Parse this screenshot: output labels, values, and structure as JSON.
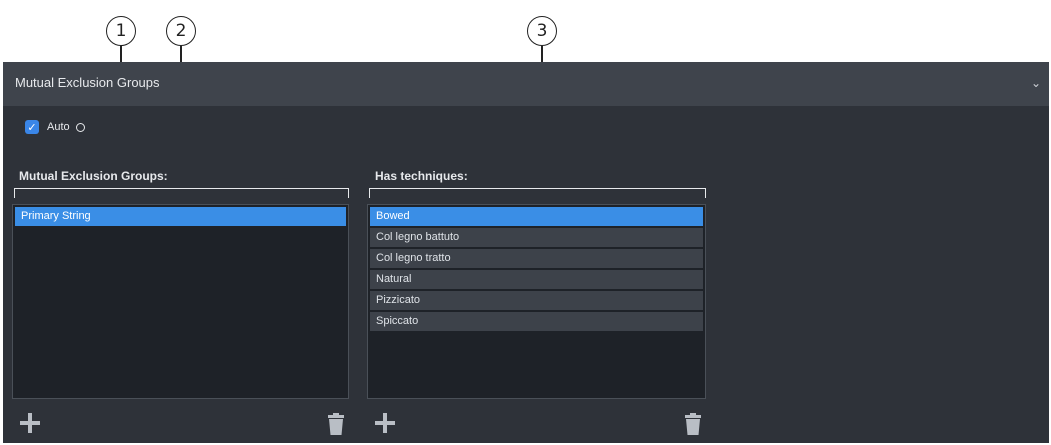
{
  "callouts": [
    "1",
    "2",
    "3"
  ],
  "panel": {
    "title": "Mutual Exclusion Groups",
    "collapse_icon": "chevron-down-icon"
  },
  "auto": {
    "label": "Auto",
    "checked": true
  },
  "groups": {
    "label": "Mutual Exclusion Groups:",
    "items": [
      {
        "label": "Primary String",
        "selected": true
      }
    ]
  },
  "techniques": {
    "label": "Has techniques:",
    "items": [
      {
        "label": "Bowed",
        "selected": true
      },
      {
        "label": "Col legno battuto",
        "selected": false
      },
      {
        "label": "Col legno tratto",
        "selected": false
      },
      {
        "label": "Natural",
        "selected": false
      },
      {
        "label": "Pizzicato",
        "selected": false
      },
      {
        "label": "Spiccato",
        "selected": false
      }
    ]
  },
  "colors": {
    "panel_bg": "#2e3239",
    "header_bg": "#3f444c",
    "accent": "#3a8ee6"
  }
}
